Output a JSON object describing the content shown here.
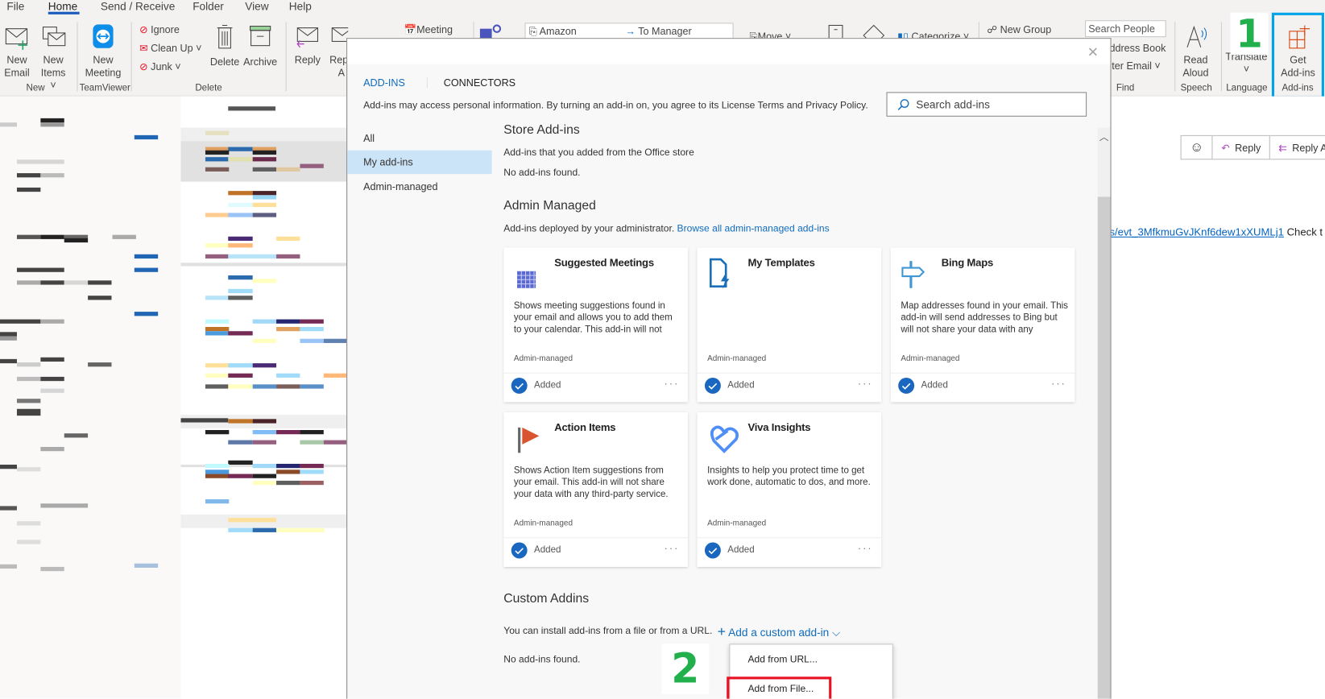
{
  "ribbon": {
    "tabs": [
      "File",
      "Home",
      "Send / Receive",
      "Folder",
      "View",
      "Help"
    ],
    "active_tab": "Home",
    "new_email": [
      "New",
      "Email"
    ],
    "new_items": [
      "New",
      "Items ˅"
    ],
    "group_new": "New",
    "new_meeting": [
      "New",
      "Meeting"
    ],
    "group_teamviewer": "TeamViewer",
    "ignore": "Ignore",
    "clean_up": "Clean Up ˅",
    "junk": "Junk ˅",
    "delete": "Delete",
    "archive": "Archive",
    "group_delete": "Delete",
    "reply": "Reply",
    "reply_all_partial": [
      "Rep",
      "A"
    ],
    "meeting": "Meeting",
    "quick_steps": [
      "Amazon",
      "To Manager"
    ],
    "move": "Move ˅",
    "categorize": "Categorize ˅",
    "new_group": "New Group",
    "search_people_placeholder": "Search People",
    "address_book": "ddress Book",
    "filter_email": "lter Email ˅",
    "group_find": "Find",
    "read_aloud": [
      "Read",
      "Aloud"
    ],
    "group_speech": "Speech",
    "translate": "Translate",
    "translate_caret": "˅",
    "group_language": "Language",
    "get_addins": [
      "Get",
      "Add-ins"
    ],
    "group_addins": "Add-ins"
  },
  "annotations": {
    "step1": "1",
    "step2": "2",
    "step_color": "#21b04b",
    "highlight_blue": "#00a2e8",
    "highlight_red": "#e81123"
  },
  "reading_pane": {
    "reply": "Reply",
    "reply_all": "Reply All",
    "link_text": "s/evt_3MfkmuGvJKnf6dew1xXUMLj1",
    "after_link": " Check t"
  },
  "dialog": {
    "tabs": [
      "ADD-INS",
      "CONNECTORS"
    ],
    "active_tab": "ADD-INS",
    "disclaimer": "Add-ins may access personal information. By turning an add-in on, you agree to its License Terms and Privacy Policy.",
    "search_placeholder": "Search add-ins",
    "nav": [
      "All",
      "My add-ins",
      "Admin-managed"
    ],
    "nav_selected": "My add-ins",
    "store": {
      "heading": "Store Add-ins",
      "sub": "Add-ins that you added from the Office store",
      "empty": "No add-ins found."
    },
    "admin": {
      "heading": "Admin Managed",
      "sub": "Add-ins deployed by your administrator.",
      "browse_link": "Browse all admin-managed add-ins",
      "cards": [
        {
          "title": "Suggested Meetings",
          "icon": "calendar-grid-icon",
          "desc": "Shows meeting suggestions found in your email and allows you to add them to your calendar. This add-in will not",
          "managed": "Admin-managed",
          "status": "Added"
        },
        {
          "title": "My Templates",
          "icon": "document-lightning-icon",
          "desc": "",
          "managed": "Admin-managed",
          "status": "Added"
        },
        {
          "title": "Bing Maps",
          "icon": "signpost-icon",
          "desc": "Map addresses found in your email. This add-in will send addresses to Bing but will not share your data with any",
          "managed": "Admin-managed",
          "status": "Added"
        },
        {
          "title": "Action Items",
          "icon": "flag-icon",
          "desc": "Shows Action Item suggestions from your email. This add-in will not share your data with any third-party service.",
          "managed": "Admin-managed",
          "status": "Added"
        },
        {
          "title": "Viva Insights",
          "icon": "heart-insights-icon",
          "desc": "Insights to help you protect time to get work done, automatic to dos, and more.",
          "managed": "Admin-managed",
          "status": "Added"
        }
      ]
    },
    "custom": {
      "heading": "Custom Addins",
      "sub": "You can install add-ins from a file or from a URL.",
      "add_button": "Add a custom add-in",
      "empty": "No add-ins found.",
      "menu": [
        "Add from URL...",
        "Add from File..."
      ]
    }
  }
}
